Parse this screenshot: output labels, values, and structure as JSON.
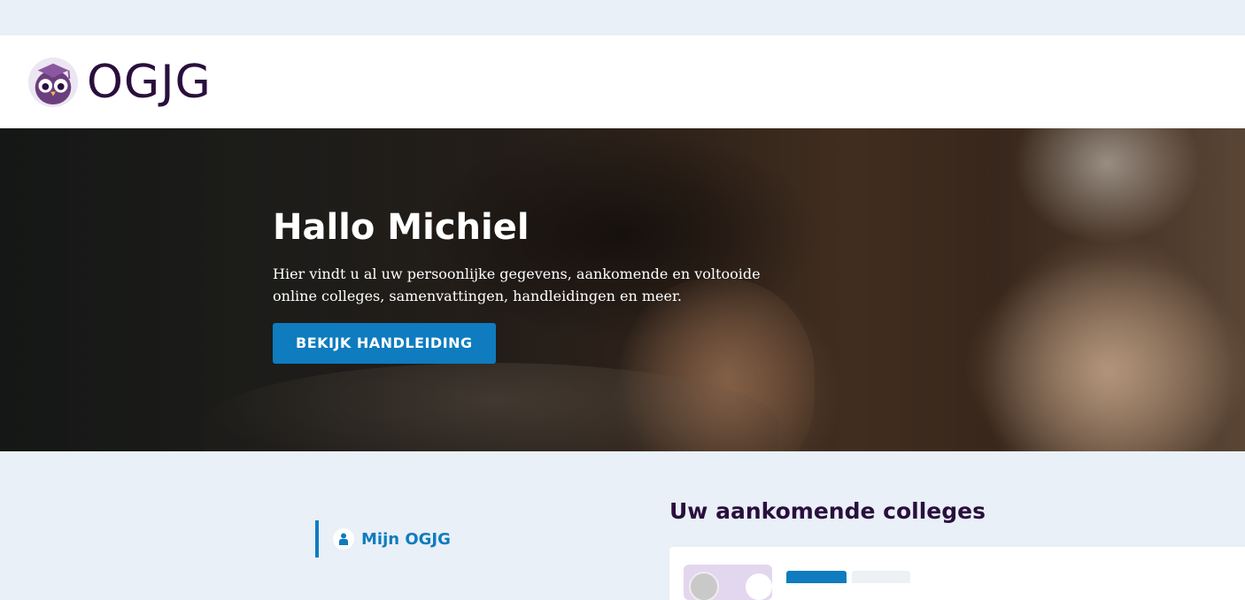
{
  "brand": {
    "name": "OGJG",
    "logo_icon": "owl-graduation-cap-icon"
  },
  "hero": {
    "greeting": "Hallo Michiel",
    "intro": "Hier vindt u al uw persoonlijke gegevens, aankomende en voltooide online colleges, samenvattingen, handleidingen en meer.",
    "button_label": "BEKIJK HANDLEIDING",
    "background_image": "photo-young-woman-and-elderly-woman-smiling"
  },
  "sidebar": {
    "items": [
      {
        "label": "Mijn OGJG",
        "icon": "user-icon",
        "active": true
      }
    ]
  },
  "main": {
    "section_title": "Uw aankomende colleges"
  },
  "colors": {
    "accent": "#0e7cbf",
    "brand_dark": "#2a0f3d",
    "page_background": "#e9f0f7"
  }
}
